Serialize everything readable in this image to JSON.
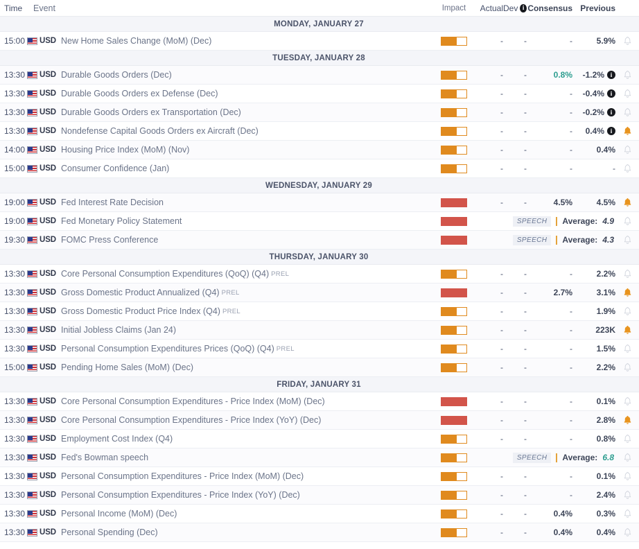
{
  "header": {
    "time": "Time",
    "event": "Event",
    "impact": "Impact",
    "actual": "Actual",
    "dev": "Dev",
    "dev_info_icon": "i",
    "consensus": "Consensus",
    "previous": "Previous"
  },
  "colors": {
    "impact_medium": "#e08a1e",
    "impact_high": "#d2544a",
    "bell_active": "#e8941f",
    "bell_inactive": "#cfd3dc",
    "teal_value": "#2c9d8f",
    "text": "#46506b",
    "day_band": "#f4f5f9"
  },
  "currency": "USD",
  "flag": "us-flag-icon",
  "speech_label": "SPEECH",
  "average_label": "Average:",
  "prel_tag": "PREL",
  "days": [
    {
      "title": "MONDAY, JANUARY 27",
      "events": [
        {
          "time": "15:00",
          "name": "New Home Sales Change (MoM) (Dec)",
          "prel": false,
          "impact": "medium",
          "actual": "-",
          "dev": "-",
          "consensus": "-",
          "previous": "5.9%",
          "revised": false,
          "bell": "inactive",
          "type": "data"
        }
      ]
    },
    {
      "title": "TUESDAY, JANUARY 28",
      "events": [
        {
          "time": "13:30",
          "name": "Durable Goods Orders (Dec)",
          "prel": false,
          "impact": "medium",
          "actual": "-",
          "dev": "-",
          "consensus": "0.8%",
          "consensus_teal": true,
          "previous": "-1.2%",
          "revised": true,
          "bell": "inactive",
          "type": "data"
        },
        {
          "time": "13:30",
          "name": "Durable Goods Orders ex Defense (Dec)",
          "prel": false,
          "impact": "medium",
          "actual": "-",
          "dev": "-",
          "consensus": "-",
          "previous": "-0.4%",
          "revised": true,
          "bell": "inactive",
          "type": "data"
        },
        {
          "time": "13:30",
          "name": "Durable Goods Orders ex Transportation (Dec)",
          "prel": false,
          "impact": "medium",
          "actual": "-",
          "dev": "-",
          "consensus": "-",
          "previous": "-0.2%",
          "revised": true,
          "bell": "inactive",
          "type": "data"
        },
        {
          "time": "13:30",
          "name": "Nondefense Capital Goods Orders ex Aircraft (Dec)",
          "prel": false,
          "impact": "medium",
          "actual": "-",
          "dev": "-",
          "consensus": "-",
          "previous": "0.4%",
          "revised": true,
          "bell": "active",
          "type": "data"
        },
        {
          "time": "14:00",
          "name": "Housing Price Index (MoM) (Nov)",
          "prel": false,
          "impact": "medium",
          "actual": "-",
          "dev": "-",
          "consensus": "-",
          "previous": "0.4%",
          "revised": false,
          "bell": "inactive",
          "type": "data"
        },
        {
          "time": "15:00",
          "name": "Consumer Confidence (Jan)",
          "prel": false,
          "impact": "medium",
          "actual": "-",
          "dev": "-",
          "consensus": "-",
          "previous": "-",
          "revised": false,
          "bell": "inactive",
          "type": "data"
        }
      ]
    },
    {
      "title": "WEDNESDAY, JANUARY 29",
      "events": [
        {
          "time": "19:00",
          "name": "Fed Interest Rate Decision",
          "prel": false,
          "impact": "high",
          "actual": "-",
          "dev": "-",
          "consensus": "4.5%",
          "previous": "4.5%",
          "revised": false,
          "bell": "active",
          "type": "data"
        },
        {
          "time": "19:00",
          "name": "Fed Monetary Policy Statement",
          "prel": false,
          "impact": "high",
          "average": "4.9",
          "average_teal": false,
          "bell": "inactive",
          "type": "speech"
        },
        {
          "time": "19:30",
          "name": "FOMC Press Conference",
          "prel": false,
          "impact": "high",
          "average": "4.3",
          "average_teal": false,
          "bell": "inactive",
          "type": "speech"
        }
      ]
    },
    {
      "title": "THURSDAY, JANUARY 30",
      "events": [
        {
          "time": "13:30",
          "name": "Core Personal Consumption Expenditures (QoQ) (Q4)",
          "prel": true,
          "impact": "medium",
          "actual": "-",
          "dev": "-",
          "consensus": "-",
          "previous": "2.2%",
          "revised": false,
          "bell": "inactive",
          "type": "data"
        },
        {
          "time": "13:30",
          "name": "Gross Domestic Product Annualized (Q4)",
          "prel": true,
          "impact": "high",
          "actual": "-",
          "dev": "-",
          "consensus": "2.7%",
          "previous": "3.1%",
          "revised": false,
          "bell": "active",
          "type": "data"
        },
        {
          "time": "13:30",
          "name": "Gross Domestic Product Price Index (Q4)",
          "prel": true,
          "impact": "medium",
          "actual": "-",
          "dev": "-",
          "consensus": "-",
          "previous": "1.9%",
          "revised": false,
          "bell": "inactive",
          "type": "data"
        },
        {
          "time": "13:30",
          "name": "Initial Jobless Claims (Jan 24)",
          "prel": false,
          "impact": "medium",
          "actual": "-",
          "dev": "-",
          "consensus": "-",
          "previous": "223K",
          "revised": false,
          "bell": "active",
          "type": "data"
        },
        {
          "time": "13:30",
          "name": "Personal Consumption Expenditures Prices (QoQ) (Q4)",
          "prel": true,
          "impact": "medium",
          "actual": "-",
          "dev": "-",
          "consensus": "-",
          "previous": "1.5%",
          "revised": false,
          "bell": "inactive",
          "type": "data"
        },
        {
          "time": "15:00",
          "name": "Pending Home Sales (MoM) (Dec)",
          "prel": false,
          "impact": "medium",
          "actual": "-",
          "dev": "-",
          "consensus": "-",
          "previous": "2.2%",
          "revised": false,
          "bell": "inactive",
          "type": "data"
        }
      ]
    },
    {
      "title": "FRIDAY, JANUARY 31",
      "events": [
        {
          "time": "13:30",
          "name": "Core Personal Consumption Expenditures - Price Index (MoM) (Dec)",
          "prel": false,
          "impact": "high",
          "actual": "-",
          "dev": "-",
          "consensus": "-",
          "previous": "0.1%",
          "revised": false,
          "bell": "inactive",
          "type": "data"
        },
        {
          "time": "13:30",
          "name": "Core Personal Consumption Expenditures - Price Index (YoY) (Dec)",
          "prel": false,
          "impact": "high",
          "actual": "-",
          "dev": "-",
          "consensus": "-",
          "previous": "2.8%",
          "revised": false,
          "bell": "active",
          "type": "data"
        },
        {
          "time": "13:30",
          "name": "Employment Cost Index (Q4)",
          "prel": false,
          "impact": "medium",
          "actual": "-",
          "dev": "-",
          "consensus": "-",
          "previous": "0.8%",
          "revised": false,
          "bell": "inactive",
          "type": "data"
        },
        {
          "time": "13:30",
          "name": "Fed's Bowman speech",
          "prel": false,
          "impact": "medium",
          "average": "6.8",
          "average_teal": true,
          "bell": "inactive",
          "type": "speech"
        },
        {
          "time": "13:30",
          "name": "Personal Consumption Expenditures - Price Index (MoM) (Dec)",
          "prel": false,
          "impact": "medium",
          "actual": "-",
          "dev": "-",
          "consensus": "-",
          "previous": "0.1%",
          "revised": false,
          "bell": "inactive",
          "type": "data"
        },
        {
          "time": "13:30",
          "name": "Personal Consumption Expenditures - Price Index (YoY) (Dec)",
          "prel": false,
          "impact": "medium",
          "actual": "-",
          "dev": "-",
          "consensus": "-",
          "previous": "2.4%",
          "revised": false,
          "bell": "inactive",
          "type": "data"
        },
        {
          "time": "13:30",
          "name": "Personal Income (MoM) (Dec)",
          "prel": false,
          "impact": "medium",
          "actual": "-",
          "dev": "-",
          "consensus": "0.4%",
          "previous": "0.3%",
          "revised": false,
          "bell": "inactive",
          "type": "data"
        },
        {
          "time": "13:30",
          "name": "Personal Spending (Dec)",
          "prel": false,
          "impact": "medium",
          "actual": "-",
          "dev": "-",
          "consensus": "0.4%",
          "previous": "0.4%",
          "revised": false,
          "bell": "inactive",
          "type": "data"
        }
      ]
    }
  ]
}
